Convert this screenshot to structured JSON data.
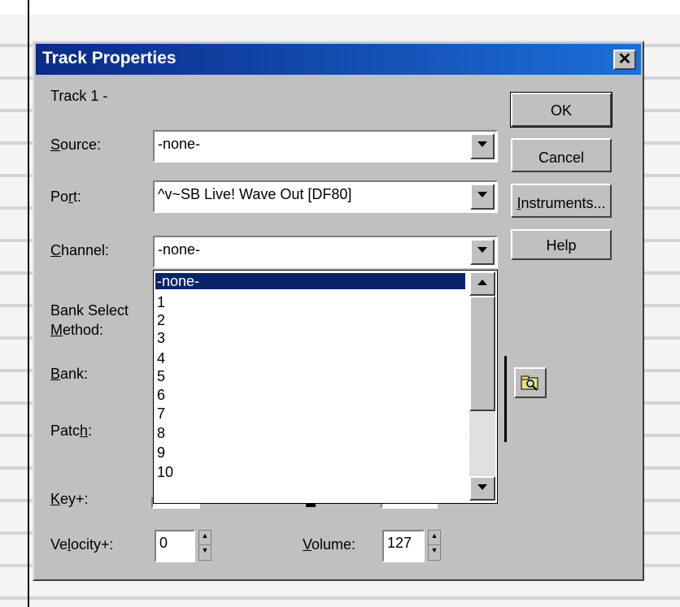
{
  "dialog": {
    "title": "Track Properties",
    "close_glyph": "✕",
    "track_label": "Track 1 -"
  },
  "labels": {
    "source": "Source:",
    "source_key": "S",
    "source_rest": "ource:",
    "port_a": "Po",
    "port_key": "r",
    "port_b": "t:",
    "channel_key": "C",
    "channel_rest": "hannel:",
    "bank_select": "Bank Select",
    "method_key": "M",
    "method_rest": "ethod:",
    "bank_key": "B",
    "bank_rest": "ank:",
    "patch_a": "Patc",
    "patch_key": "h",
    "patch_b": ":",
    "key_key": "K",
    "key_rest": "ey+:",
    "velocity_a": "Ve",
    "velocity_key": "l",
    "velocity_b": "ocity+:",
    "volume_key": "V",
    "volume_rest": "olume:"
  },
  "fields": {
    "source_value": "-none-",
    "port_value": "^v~SB Live! Wave Out [DF80]",
    "channel_value": "-none-",
    "velocity_value": "0",
    "volume_value": "127"
  },
  "buttons": {
    "ok": "OK",
    "cancel": "Cancel",
    "instruments_key": "I",
    "instruments_rest": "nstruments...",
    "help": "Help"
  },
  "channel_list": {
    "items": [
      "-none-",
      "1",
      "2",
      "3",
      "4",
      "5",
      "6",
      "7",
      "8",
      "9",
      "10"
    ],
    "selected": "-none-"
  },
  "icons": {
    "browse": "folder-search-icon"
  }
}
